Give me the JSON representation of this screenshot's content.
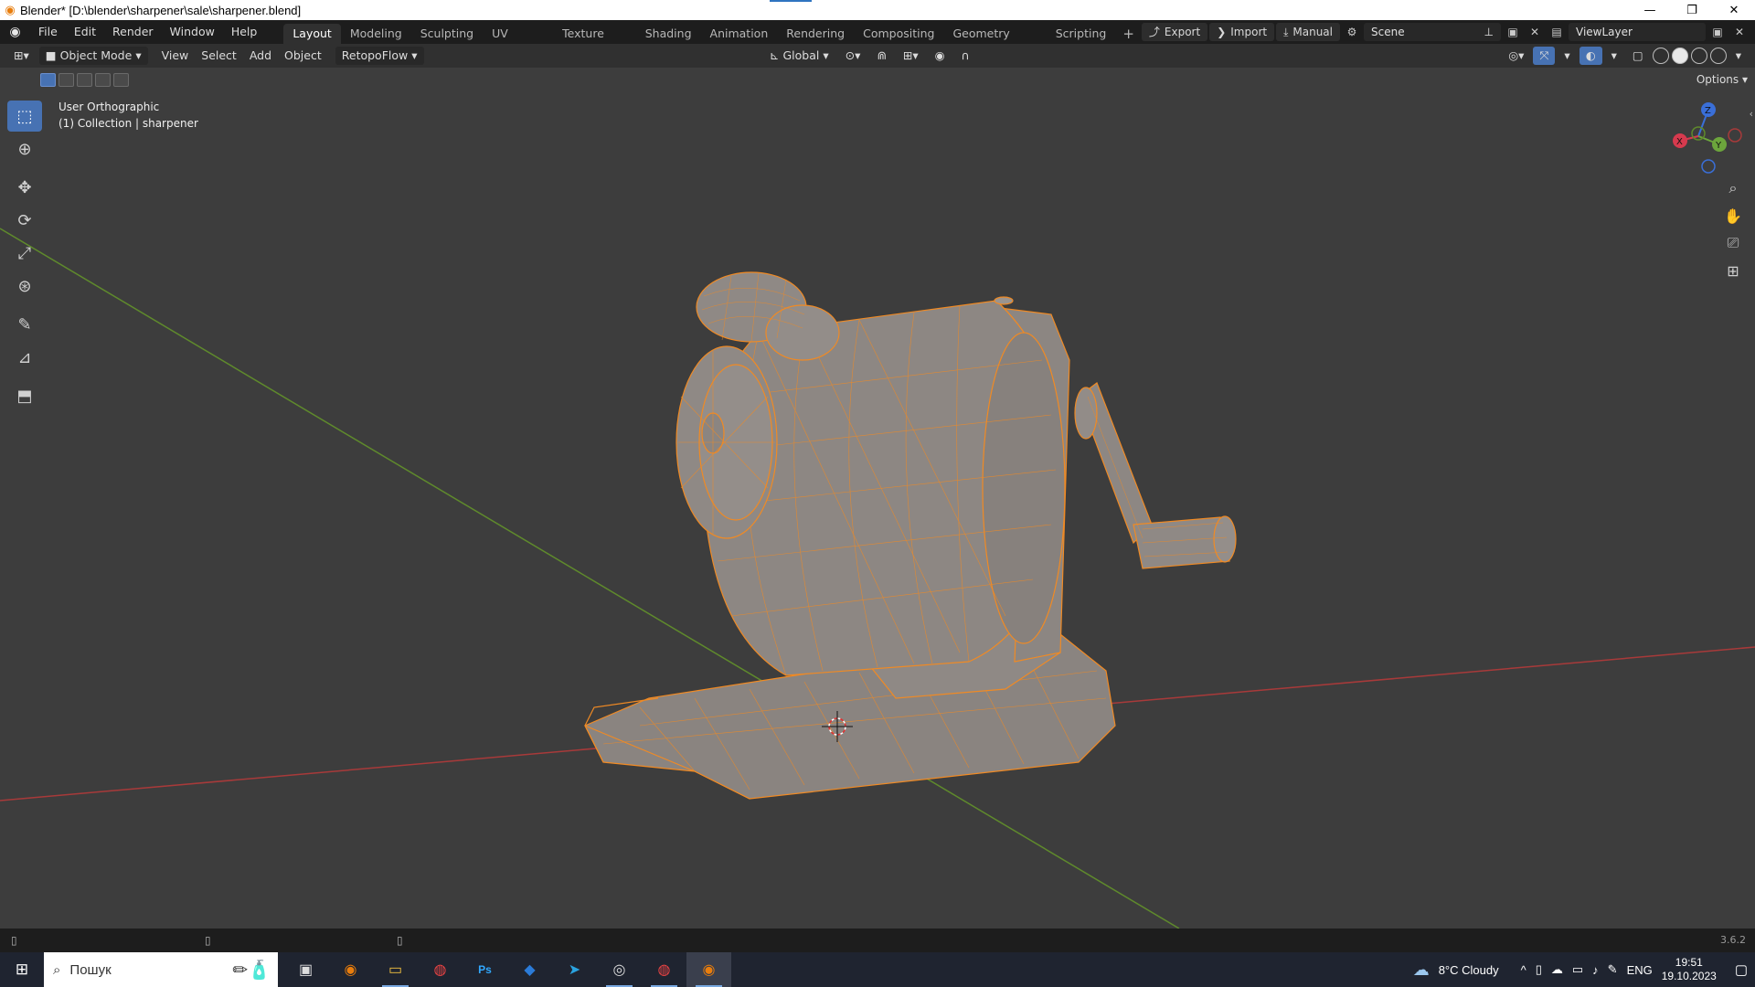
{
  "titlebar": {
    "title": "Blender* [D:\\blender\\sharpener\\sale\\sharpener.blend]",
    "minimize": "—",
    "maximize": "❐",
    "close": "✕"
  },
  "menu": {
    "items": [
      "File",
      "Edit",
      "Render",
      "Window",
      "Help"
    ]
  },
  "workspaces": {
    "tabs": [
      "Layout",
      "Modeling",
      "Sculpting",
      "UV Editing",
      "Texture Paint",
      "Shading",
      "Animation",
      "Rendering",
      "Compositing",
      "Geometry Nodes",
      "Scripting"
    ],
    "active": "Layout",
    "add_label": "+"
  },
  "header_right": {
    "export_label": "Export",
    "import_label": "Import",
    "manual_label": "Manual",
    "scene_name": "Scene",
    "view_layer_name": "ViewLayer"
  },
  "viewport_header": {
    "mode": "Object Mode",
    "menus": [
      "View",
      "Select",
      "Add",
      "Object"
    ],
    "addon_menu": "RetopoFlow",
    "transform_orientation": "Global",
    "options_label": "Options"
  },
  "viewport": {
    "view_name": "User Orthographic",
    "collection_info": "(1) Collection | sharpener",
    "gizmo": {
      "x_label": "X",
      "y_label": "Y",
      "z_label": "Z"
    },
    "colors": {
      "background": "#3d3d3d",
      "x_axis": "#a83a3a",
      "y_axis": "#5f8a2c",
      "wireframe": "#f08a24",
      "mesh": "#8a8480",
      "selection": "#4772b3"
    }
  },
  "status": {
    "version": "3.6.2"
  },
  "taskbar": {
    "search_placeholder": "Пошук",
    "weather": "8°C  Cloudy",
    "language": "ENG",
    "time": "19:51",
    "date": "19.10.2023"
  }
}
